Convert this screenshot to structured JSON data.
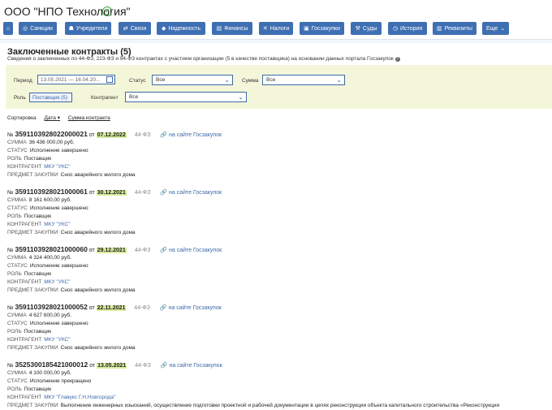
{
  "company": {
    "name": "ООО \"НПО Технология\"",
    "verified_icon": "check-circle-icon"
  },
  "nav": {
    "buttons": [
      {
        "label": "",
        "icon": "home-icon",
        "glyph": "⌂"
      },
      {
        "label": "Санкции",
        "icon": "globe-icon",
        "glyph": "◎"
      },
      {
        "label": "Учредители",
        "icon": "users-icon",
        "glyph": "☗"
      },
      {
        "label": "Связи",
        "icon": "links-icon",
        "glyph": "⇄"
      },
      {
        "label": "Надежность",
        "icon": "shield-icon",
        "glyph": "◆"
      },
      {
        "label": "Финансы",
        "icon": "finance-icon",
        "glyph": "▤"
      },
      {
        "label": "Налоги",
        "icon": "tax-icon",
        "glyph": "✕"
      },
      {
        "label": "Госзакупки",
        "icon": "procurement-icon",
        "glyph": "▣"
      },
      {
        "label": "Суды",
        "icon": "gavel-icon",
        "glyph": "⚒"
      },
      {
        "label": "История",
        "icon": "history-icon",
        "glyph": "◷"
      },
      {
        "label": "Реквизиты",
        "icon": "document-icon",
        "glyph": "▥"
      },
      {
        "label": "Еще",
        "icon": "chevron-down-icon",
        "glyph": "⌄"
      }
    ]
  },
  "section": {
    "title": "Заключенные контракты (5)",
    "subtitle": "Сведения о заключенных по 44-ФЗ, 223-ФЗ и 94-ФЗ контрактах с участием организации (5 в качестве поставщика) на основании данных портала Госзакупок"
  },
  "filters": {
    "period_label": "Период",
    "period_value": "13.05.2021 — 16.04.20...",
    "status_label": "Статус",
    "status_value": "Все",
    "sum_label": "Сумма",
    "sum_value": "Все",
    "role_label": "Роль",
    "role_value": "Поставщик (5)",
    "counterparty_label": "Контрагент",
    "counterparty_value": "Все"
  },
  "sort": {
    "label": "Сортировка",
    "options": [
      "Дата",
      "Сумма контракта"
    ],
    "active_arrow": "▾"
  },
  "labels": {
    "sum": "СУММА",
    "status": "СТАТУС",
    "role": "РОЛЬ",
    "counterparty": "КОНТРАГЕНТ",
    "subject": "ПРЕДМЕТ ЗАКУПКИ",
    "number_prefix": "№",
    "date_prefix": "от",
    "portal_link": "на сайте Госзакупок"
  },
  "contracts": [
    {
      "number": "3591103928022000021",
      "date": "07.12.2022",
      "law": "44-ФЗ",
      "sum": "36 436 000,00 руб.",
      "status": "Исполнение завершено",
      "role": "Поставщик",
      "counterparty": "МКУ \"УКС\"",
      "subject": "Снос аварийного жилого дома"
    },
    {
      "number": "3591103928021000061",
      "date": "30.12.2021",
      "law": "44-ФЗ",
      "sum": "8 161 600,00 руб.",
      "status": "Исполнение завершено",
      "role": "Поставщик",
      "counterparty": "МКУ \"УКС\"",
      "subject": "Снос аварийного жилого дома"
    },
    {
      "number": "3591103928021000060",
      "date": "29.12.2021",
      "law": "44-ФЗ",
      "sum": "4 324 400,00 руб.",
      "status": "Исполнение завершено",
      "role": "Поставщик",
      "counterparty": "МКУ \"УКС\"",
      "subject": "Снос аварийного жилого дома"
    },
    {
      "number": "3591103928021000052",
      "date": "22.11.2021",
      "law": "44-ФЗ",
      "sum": "4 627 600,00 руб.",
      "status": "Исполнение завершено",
      "role": "Поставщик",
      "counterparty": "МКУ \"УКС\"",
      "subject": "Снос аварийного жилого дома"
    },
    {
      "number": "3525300185421000012",
      "date": "13.05.2021",
      "law": "44-ФЗ",
      "sum": "4 100 000,00 руб.",
      "status": "Исполнение прекращено",
      "role": "Поставщик",
      "counterparty": "МКУ \"Главукс Г.Н.Новгорода\"",
      "subject": "Выполнение инженерных изысканий, осуществление подготовки проектной и рабочей документации в целях реконструкции объекта капитального строительства «Реконструкция"
    }
  ],
  "colors": {
    "accent": "#3f6fb3",
    "link": "#3d6aa8",
    "date_highlight": "#d8ed9c",
    "filter_bg": "#f4f6d9",
    "verified": "#3aa53a"
  }
}
